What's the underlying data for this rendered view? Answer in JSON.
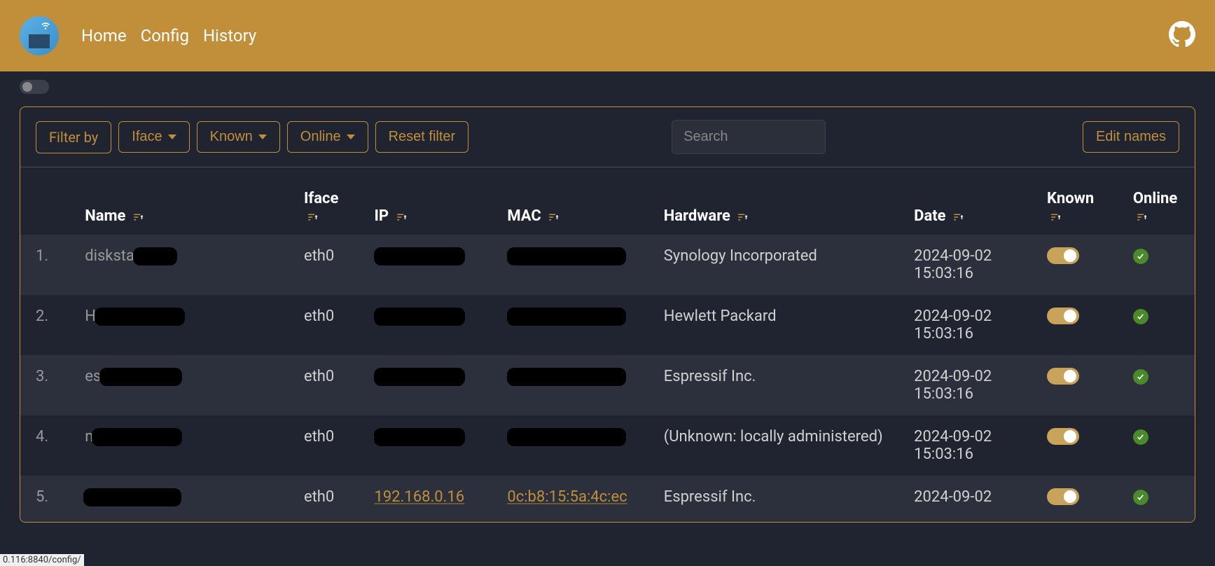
{
  "header": {
    "nav": [
      "Home",
      "Config",
      "History"
    ]
  },
  "toolbar": {
    "filter_by": "Filter by",
    "iface": "Iface",
    "known": "Known",
    "online": "Online",
    "reset": "Reset filter",
    "search_placeholder": "Search",
    "edit_names": "Edit names"
  },
  "columns": {
    "name": "Name",
    "iface": "Iface",
    "ip": "IP",
    "mac": "MAC",
    "hardware": "Hardware",
    "date": "Date",
    "known": "Known",
    "online": "Online"
  },
  "rows": [
    {
      "num": "1.",
      "name_prefix": "disksta",
      "iface": "eth0",
      "hardware": "Synology Incorporated",
      "date": "2024-09-02 15:03:16",
      "known": true,
      "online": true
    },
    {
      "num": "2.",
      "name_prefix": "H",
      "iface": "eth0",
      "hardware": "Hewlett Packard",
      "date": "2024-09-02 15:03:16",
      "known": true,
      "online": true
    },
    {
      "num": "3.",
      "name_prefix": "es",
      "iface": "eth0",
      "hardware": "Espressif Inc.",
      "date": "2024-09-02 15:03:16",
      "known": true,
      "online": true
    },
    {
      "num": "4.",
      "name_prefix": "n",
      "iface": "eth0",
      "hardware": "(Unknown: locally administered)",
      "date": "2024-09-02 15:03:16",
      "known": true,
      "online": true
    },
    {
      "num": "5.",
      "name_prefix": "",
      "iface": "eth0",
      "ip_visible": "192.168.0.16",
      "mac_visible": "0c:b8:15:5a:4c:ec",
      "hardware": "Espressif Inc.",
      "date": "2024-09-02",
      "known": true,
      "online": true
    }
  ],
  "status_bar": "0.116:8840/config/"
}
